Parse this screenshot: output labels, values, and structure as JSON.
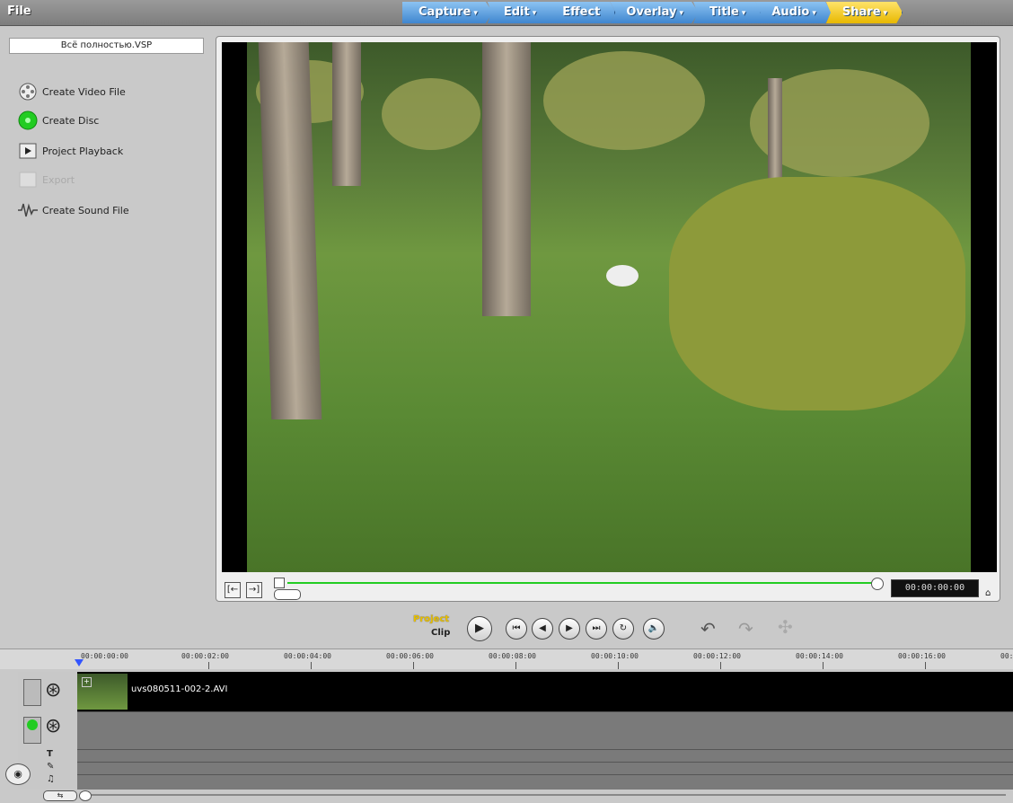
{
  "menubar": {
    "file": "File",
    "tabs": [
      {
        "label": "Capture",
        "has_dropdown": true
      },
      {
        "label": "Edit",
        "has_dropdown": true
      },
      {
        "label": "Effect",
        "has_dropdown": false
      },
      {
        "label": "Overlay",
        "has_dropdown": true
      },
      {
        "label": "Title",
        "has_dropdown": true
      },
      {
        "label": "Audio",
        "has_dropdown": true
      },
      {
        "label": "Share",
        "has_dropdown": true,
        "active": true
      }
    ],
    "dropdown_glyph": "▾"
  },
  "sidebar": {
    "project_name": "Всё полностью.VSP",
    "items": [
      {
        "label": "Create Video File",
        "icon": "film-reel-icon",
        "enabled": true
      },
      {
        "label": "Create Disc",
        "icon": "disc-icon",
        "enabled": true
      },
      {
        "label": "Project Playback",
        "icon": "play-icon",
        "enabled": true
      },
      {
        "label": "Export",
        "icon": "export-icon",
        "enabled": false
      },
      {
        "label": "Create Sound File",
        "icon": "waveform-icon",
        "enabled": true
      }
    ]
  },
  "preview": {
    "timecode": "00:00:00:00",
    "trim_in_label": "[←",
    "trim_out_label": "→]"
  },
  "transport": {
    "project_label": "Project",
    "clip_label": "Clip",
    "mode": "Project"
  },
  "timeline": {
    "ruler_labels": [
      "00:00:00:00",
      "00:00:02:00",
      "00:00:04:00",
      "00:00:06:00",
      "00:00:08:00",
      "00:00:10:00",
      "00:00:12:00",
      "00:00:14:00",
      "00:00:16:00",
      "00:"
    ],
    "video_clip_name": "uvs080511-002-2.AVI"
  },
  "colors": {
    "tab_blue": "#4a90d9",
    "tab_active": "#f2c200",
    "timeline_track": "#7a7a7a",
    "scrub_line": "#22cc22"
  }
}
